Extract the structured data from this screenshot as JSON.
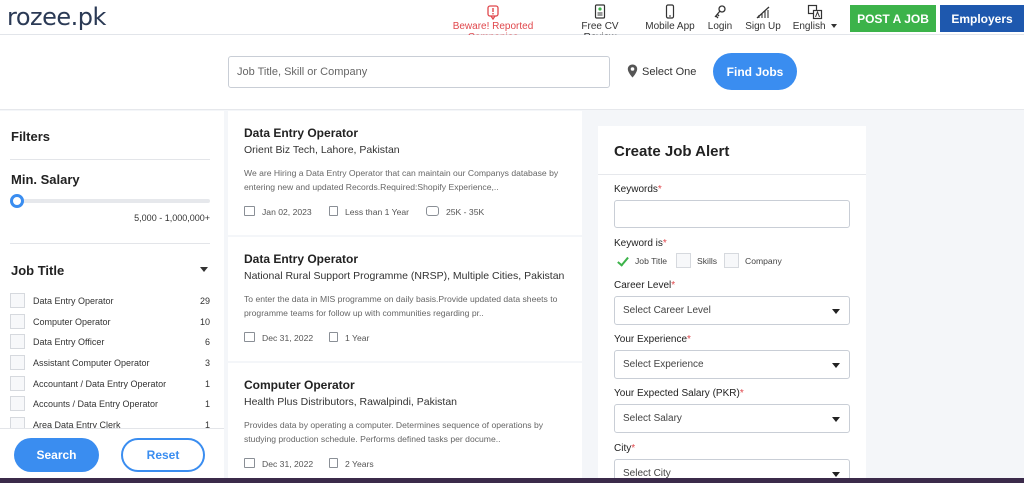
{
  "nav": {
    "logo": "rozee.pk",
    "items": [
      {
        "label": "Beware! Reported Companies",
        "icon": "alert-icon"
      },
      {
        "label": "Free CV Review",
        "icon": "cv-icon"
      },
      {
        "label": "Mobile App",
        "icon": "mobile-icon"
      },
      {
        "label": "Login",
        "icon": "key-icon"
      },
      {
        "label": "Sign Up",
        "icon": "signup-icon"
      },
      {
        "label": "English",
        "icon": "language-icon"
      }
    ],
    "post_job": "POST A JOB",
    "employers": "Employers"
  },
  "search": {
    "placeholder": "Job Title, Skill or Company",
    "location": "Select One",
    "button": "Find Jobs"
  },
  "filters": {
    "title": "Filters",
    "min_salary_title": "Min. Salary",
    "salary_range": "5,000 - 1,000,000+",
    "job_title_heading": "Job Title",
    "job_titles": [
      {
        "label": "Data Entry Operator",
        "count": "29"
      },
      {
        "label": "Computer Operator",
        "count": "10"
      },
      {
        "label": "Data Entry Officer",
        "count": "6"
      },
      {
        "label": "Assistant Computer Operator",
        "count": "3"
      },
      {
        "label": "Accountant / Data Entry Operator",
        "count": "1"
      },
      {
        "label": "Accounts / Data Entry Operator",
        "count": "1"
      },
      {
        "label": "Area Data Entry Clerk",
        "count": "1"
      }
    ],
    "search_button": "Search",
    "reset_button": "Reset"
  },
  "jobs": [
    {
      "title": "Data Entry Operator",
      "company": "Orient Biz Tech, Lahore, Pakistan",
      "description": "We are Hiring a Data Entry Operator that can maintain our Companys database by entering new and updated Records.Required:Shopify Experience,..",
      "date": "Jan 02, 2023",
      "experience": "Less than 1 Year",
      "salary": "25K - 35K"
    },
    {
      "title": "Data Entry Operator",
      "company": "National Rural Support Programme (NRSP), Multiple Cities, Pakistan",
      "description": "To enter the data in MIS programme on daily basis.Provide updated data sheets to programme teams for follow up with communities regarding pr..",
      "date": "Dec 31, 2022",
      "experience": "1 Year",
      "salary": ""
    },
    {
      "title": "Computer Operator",
      "company": "Health Plus Distributors, Rawalpindi, Pakistan",
      "description": "Provides data by operating a computer. Determines sequence of operations by studying production schedule. Performs defined tasks per docume..",
      "date": "Dec 31, 2022",
      "experience": "2 Years",
      "salary": ""
    }
  ],
  "alert": {
    "title": "Create Job Alert",
    "keywords_label": "Keywords",
    "keyword_is_label": "Keyword is",
    "keyword_options": [
      {
        "label": "Job Title",
        "checked": true
      },
      {
        "label": "Skills",
        "checked": false
      },
      {
        "label": "Company",
        "checked": false
      }
    ],
    "career_level_label": "Career Level",
    "career_level_value": "Select Career Level",
    "experience_label": "Your Experience",
    "experience_value": "Select Experience",
    "salary_label": "Your Expected Salary (PKR)",
    "salary_value": "Select Salary",
    "city_label": "City",
    "city_value": "Select City",
    "required_mark": "*"
  }
}
